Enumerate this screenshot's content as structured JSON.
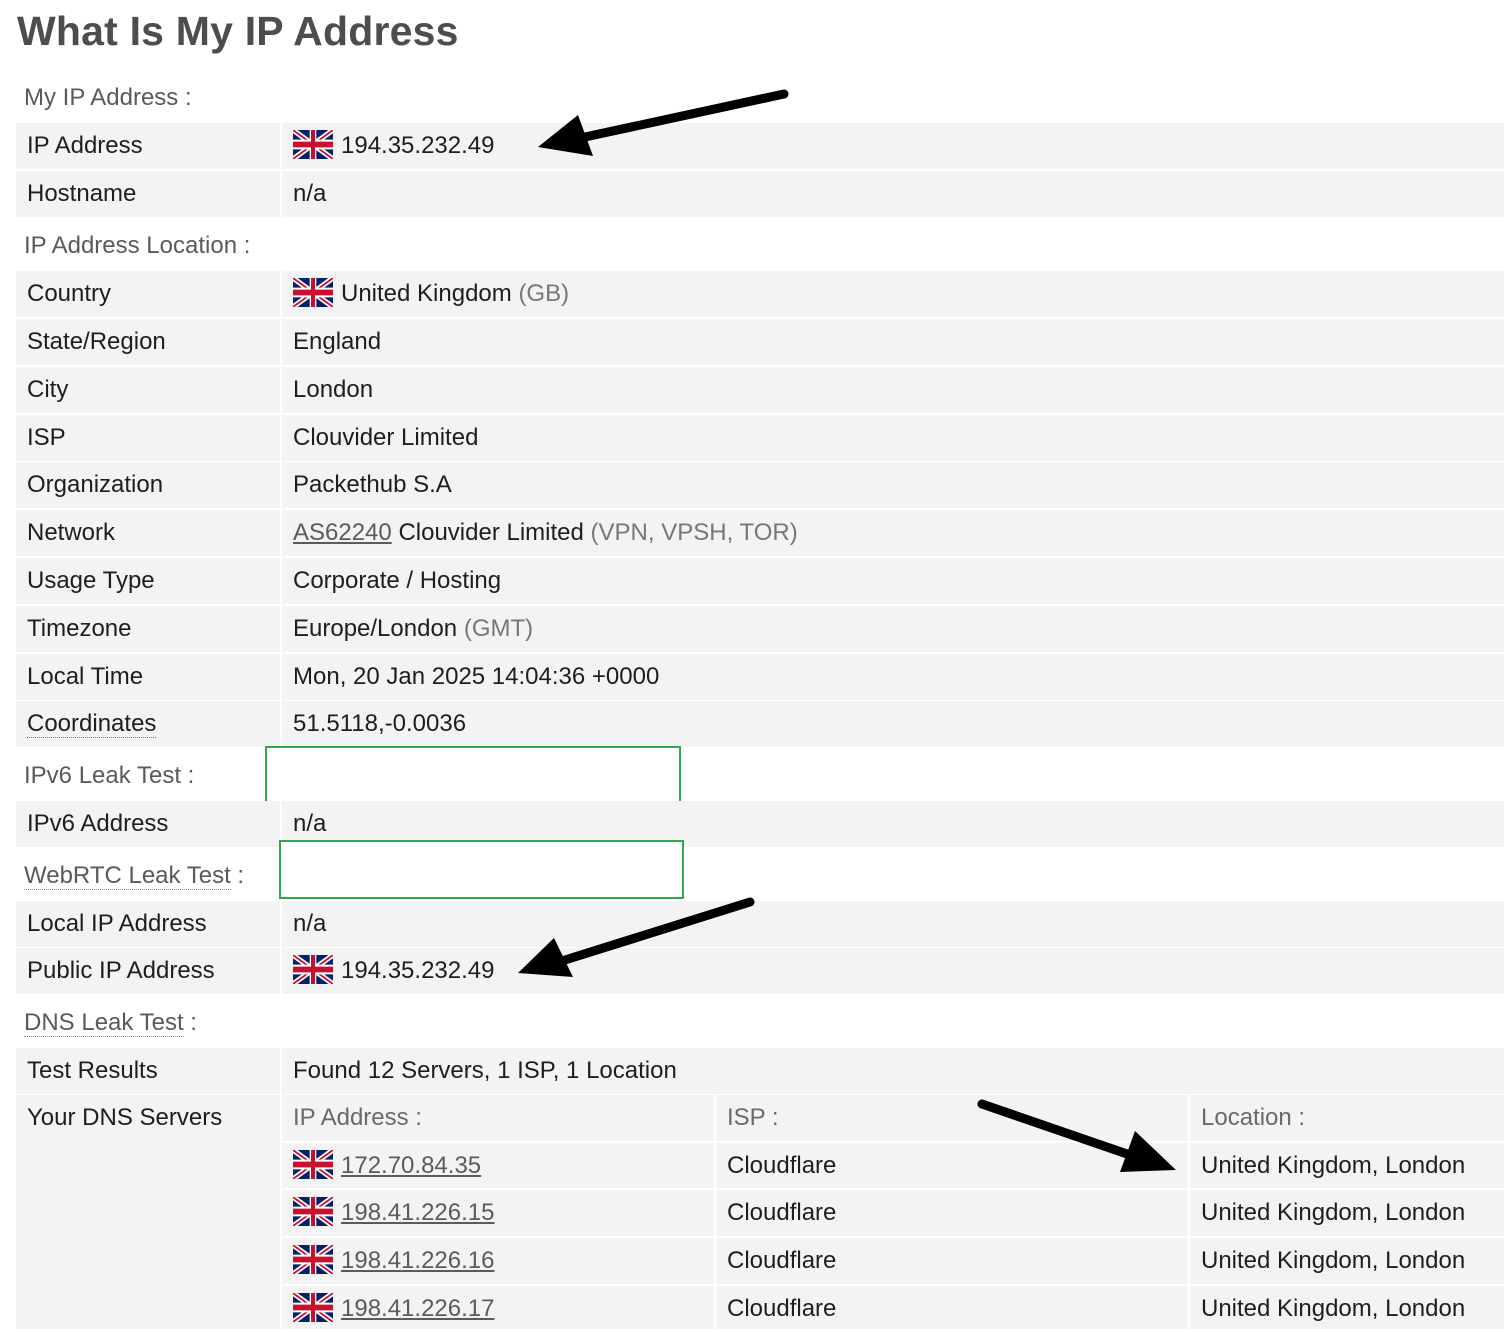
{
  "page_title": "What Is My IP Address",
  "sections": {
    "my_ip": "My IP Address :",
    "location": "IP Address Location :",
    "ipv6": "IPv6 Leak Test :",
    "webrtc_text": "WebRTC Leak Test",
    "webrtc_colon": " :",
    "dns_text": "DNS Leak Test",
    "dns_colon": " :"
  },
  "my_ip": {
    "ip_label": "IP Address",
    "ip_value": "194.35.232.49",
    "hostname_label": "Hostname",
    "hostname_value": "n/a"
  },
  "location": {
    "country_label": "Country",
    "country_value": "United Kingdom",
    "country_code": "(GB)",
    "region_label": "State/Region",
    "region_value": "England",
    "city_label": "City",
    "city_value": "London",
    "isp_label": "ISP",
    "isp_value": "Clouvider Limited",
    "org_label": "Organization",
    "org_value": "Packethub S.A",
    "network_label": "Network",
    "network_asn": "AS62240",
    "network_name": "Clouvider Limited",
    "network_tags": "(VPN, VPSH, TOR)",
    "usage_label": "Usage Type",
    "usage_value": "Corporate / Hosting",
    "tz_label": "Timezone",
    "tz_value": "Europe/London",
    "tz_abbr": "(GMT)",
    "time_label": "Local Time",
    "time_value": "Mon, 20 Jan 2025 14:04:36 +0000",
    "coords_label": "Coordinates",
    "coords_value": "51.5118,-0.0036"
  },
  "ipv6": {
    "label": "IPv6 Address",
    "value": "n/a"
  },
  "webrtc": {
    "local_label": "Local IP Address",
    "local_value": "n/a",
    "public_label": "Public IP Address",
    "public_value": "194.35.232.49"
  },
  "dns": {
    "results_label": "Test Results",
    "results_value": "Found 12 Servers, 1 ISP, 1 Location",
    "servers_label": "Your DNS Servers",
    "col_ip": "IP Address :",
    "col_isp": "ISP :",
    "col_location": "Location :",
    "servers": [
      {
        "ip": "172.70.84.35",
        "isp": "Cloudflare",
        "location": "United Kingdom, London"
      },
      {
        "ip": "198.41.226.15",
        "isp": "Cloudflare",
        "location": "United Kingdom, London"
      },
      {
        "ip": "198.41.226.16",
        "isp": "Cloudflare",
        "location": "United Kingdom, London"
      },
      {
        "ip": "198.41.226.17",
        "isp": "Cloudflare",
        "location": "United Kingdom, London"
      }
    ]
  },
  "colors": {
    "row_bg": "#f3f3f3",
    "title": "#4d4d4d",
    "section": "#5a5a5a",
    "muted": "#777777",
    "highlight_box": "#2fa84a",
    "arrow": "#000000"
  }
}
